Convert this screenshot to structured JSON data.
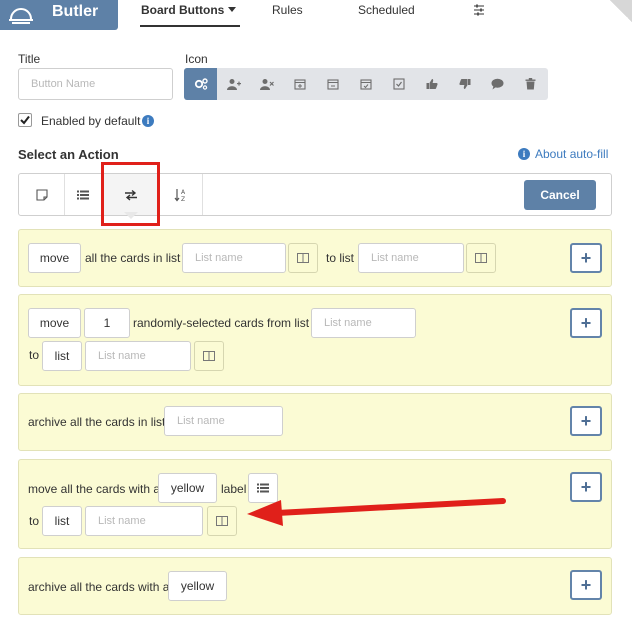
{
  "header": {
    "brand": "Butler",
    "tabs": [
      {
        "label": "Board Buttons"
      },
      {
        "label": "Rules"
      },
      {
        "label": "Scheduled"
      }
    ]
  },
  "form": {
    "title_label": "Title",
    "title_placeholder": "Button Name",
    "icon_label": "Icon",
    "enabled_label": "Enabled by default",
    "select_action_label": "Select an Action",
    "about_autofill": "About auto-fill"
  },
  "toolbar": {
    "cancel_label": "Cancel"
  },
  "rows": [
    {
      "action": "move",
      "text1": "all the cards in list",
      "list_placeholder": "List name",
      "text2": "to list",
      "list2_placeholder": "List name"
    },
    {
      "action": "move",
      "count": "1",
      "text1": "randomly-selected cards from list",
      "list_placeholder": "List name",
      "to_label": "to",
      "target": "list",
      "list2_placeholder": "List name"
    },
    {
      "text1": "archive all the cards in list",
      "list_placeholder": "List name"
    },
    {
      "text1": "move all the cards with a",
      "color": "yellow",
      "text2": "label",
      "to_label": "to",
      "target": "list",
      "list_placeholder": "List name"
    },
    {
      "text1": "archive all the cards with a",
      "color": "yellow"
    }
  ],
  "colors": {
    "accent": "#5e81a7",
    "row_bg": "#fbfbd4",
    "highlight": "#e0201a"
  }
}
